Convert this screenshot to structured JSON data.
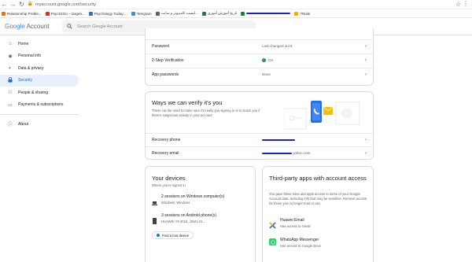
{
  "browser": {
    "url": "myaccount.google.com/security",
    "bookmarks": [
      {
        "label": "Relationship Proble...",
        "color": "#e8710a"
      },
      {
        "label": "Psych2Go – targeti...",
        "color": "#d93025"
      },
      {
        "label": "Psychology Today:...",
        "color": "#1a73e8"
      },
      {
        "label": "Telegram",
        "color": "#229ed9"
      },
      {
        "label": "لیست کامپیوتر و سایت...",
        "color": "#5f6368"
      },
      {
        "label": "تاریخ آموزش آموزی",
        "color": "#188038"
      },
      {
        "label": "",
        "color": "#188038"
      },
      {
        "label": "7Rials",
        "color": "#f9ab00"
      }
    ]
  },
  "header": {
    "logo_google": "Google",
    "logo_account": "Account",
    "search_placeholder": "Search Google Account"
  },
  "sidebar": {
    "items": [
      {
        "label": "Home",
        "icon": "home-icon"
      },
      {
        "label": "Personal info",
        "icon": "person-icon"
      },
      {
        "label": "Data & privacy",
        "icon": "toggle-icon"
      },
      {
        "label": "Security",
        "icon": "lock-icon"
      },
      {
        "label": "People & sharing",
        "icon": "people-icon"
      },
      {
        "label": "Payments & subscriptions",
        "icon": "card-icon"
      }
    ],
    "about": "About"
  },
  "signin": {
    "rows": [
      {
        "label": "Password",
        "value": "Last changed Jul 8"
      },
      {
        "label": "2-Step Verification",
        "value": "On"
      },
      {
        "label": "App passwords",
        "value": "None"
      }
    ]
  },
  "verify": {
    "title": "Ways we can verify it's you",
    "desc": "These can be used to make sure it's really you signing in or to reach you if there's suspicious activity in your account",
    "rows": [
      {
        "label": "Recovery phone",
        "value": ""
      },
      {
        "label": "Recovery email",
        "value": "yahoo.com"
      }
    ]
  },
  "devices": {
    "title": "Your devices",
    "subtitle": "Where you're signed in",
    "items": [
      {
        "name": "2 sessions on Windows computer(s)",
        "detail": "Windows, Windows"
      },
      {
        "name": "3 sessions on Android phone(s)",
        "detail": "HUAWEI Y9 2019, JKM-LX1,..."
      }
    ],
    "find_button": "Find a lost device"
  },
  "thirdparty": {
    "title": "Third-party apps with account access",
    "desc": "You gave these sites and apps access to some of your Google Account data, including info that may be sensitive. Remove access for those you no longer trust or use.",
    "apps": [
      {
        "name": "Huawei Email",
        "detail": "Has access to Gmail"
      },
      {
        "name": "WhatsApp Messenger",
        "detail": "Has access to Google Drive"
      }
    ]
  },
  "colors": {
    "accent": "#1a73e8",
    "active_bg": "#e8f0fe",
    "redaction": "#2222cc"
  }
}
